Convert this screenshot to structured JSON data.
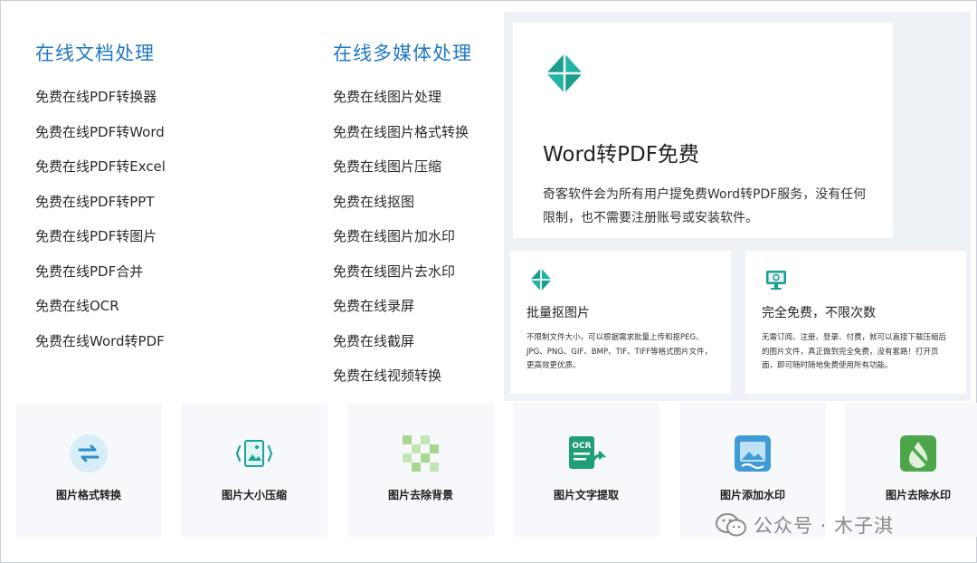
{
  "doc_column": {
    "title": "在线文档处理",
    "items": [
      "免费在线PDF转换器",
      "免费在线PDF转Word",
      "免费在线PDF转Excel",
      "免费在线PDF转PPT",
      "免费在线PDF转图片",
      "免费在线PDF合并",
      "免费在线OCR",
      "免费在线Word转PDF"
    ]
  },
  "media_column": {
    "title": "在线多媒体处理",
    "items": [
      "免费在线图片处理",
      "免费在线图片格式转换",
      "免费在线图片压缩",
      "免费在线抠图",
      "免费在线图片加水印",
      "免费在线图片去水印",
      "免费在线录屏",
      "免费在线截屏",
      "免费在线视频转换"
    ]
  },
  "hero": {
    "logo_icon": "pinwheel-logo-icon",
    "title": "Word转PDF免费",
    "description": "奇客软件会为所有用户提免费Word转PDF服务，没有任何限制，也不需要注册账号或安装软件。"
  },
  "cards": [
    {
      "icon": "pinwheel-logo-icon",
      "title": "批量抠图片",
      "description": "不限制文件大小，可以根据需求批量上传和抠PEG、JPG、PNG、GIF、BMP、TIF、TIFF等格式图片文件，更高效更优质。"
    },
    {
      "icon": "monitor-icon",
      "title": "完全免费，不限次数",
      "description": "无需订阅、注册、登录、付费，就可以直接下载压缩后的图片文件，真正做到完全免费，没有套路！打开页面，即可随时随地免费使用所有功能。"
    }
  ],
  "tiles": [
    {
      "icon": "format-convert-icon",
      "label": "图片格式转换"
    },
    {
      "icon": "resize-compress-icon",
      "label": "图片大小压缩"
    },
    {
      "icon": "remove-background-icon",
      "label": "图片去除背景"
    },
    {
      "icon": "ocr-extract-icon",
      "label": "图片文字提取"
    },
    {
      "icon": "add-watermark-icon",
      "label": "图片添加水印"
    },
    {
      "icon": "remove-watermark-icon",
      "label": "图片去除水印"
    }
  ],
  "watermark": {
    "icon": "wechat-icon",
    "text": "公众号 · 木子淇"
  },
  "colors": {
    "accent_blue": "#1f78c8",
    "brand_teal": "#1a9e8f",
    "panel_bg": "#eef1f6",
    "tile_bg": "#f6f8fb"
  }
}
